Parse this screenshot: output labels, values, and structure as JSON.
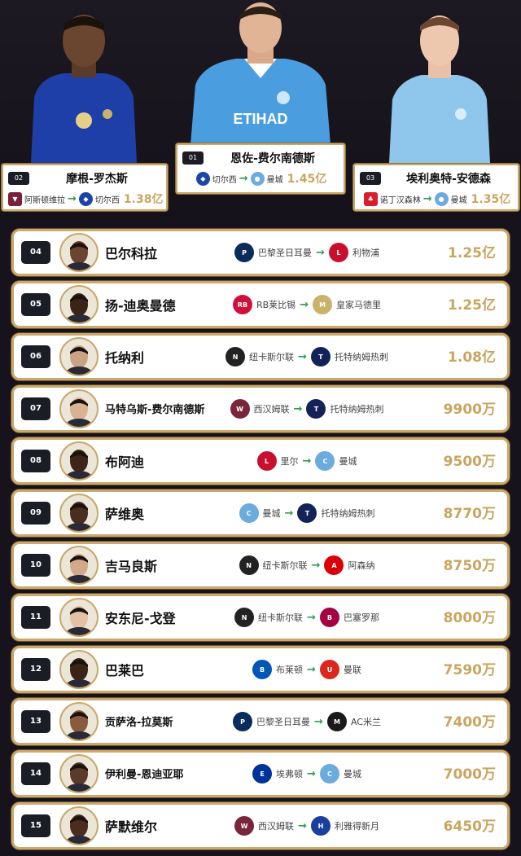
{
  "podium": [
    {
      "rank": "02",
      "name": "摩根-罗杰斯",
      "from": "阿斯顿维拉",
      "from_icon": "aston-villa-crest-icon",
      "to": "切尔西",
      "to_icon": "chelsea-crest-icon",
      "fee": "1.38亿",
      "shirt_color": "#1f3fa8"
    },
    {
      "rank": "01",
      "name": "恩佐-费尔南德斯",
      "from": "切尔西",
      "from_icon": "chelsea-crest-icon",
      "to": "曼城",
      "to_icon": "man-city-crest-icon",
      "fee": "1.45亿",
      "shirt_color": "#4a9ee0",
      "sponsor": "ETIHAD"
    },
    {
      "rank": "03",
      "name": "埃利奥特-安德森",
      "from": "诺丁汉森林",
      "from_icon": "nottingham-forest-crest-icon",
      "to": "曼城",
      "to_icon": "man-city-crest-icon",
      "fee": "1.35亿",
      "shirt_color": "#8ec6ec"
    }
  ],
  "list": [
    {
      "rank": "04",
      "name": "巴尔科拉",
      "from": "巴黎圣日耳曼",
      "from_icon": "psg-crest-icon",
      "to": "利物浦",
      "to_icon": "liverpool-crest-icon",
      "fee": "1.25亿"
    },
    {
      "rank": "05",
      "name": "扬-迪奥曼德",
      "from": "RB莱比锡",
      "from_icon": "rb-leipzig-crest-icon",
      "to": "皇家马德里",
      "to_icon": "real-madrid-crest-icon",
      "fee": "1.25亿"
    },
    {
      "rank": "06",
      "name": "托纳利",
      "from": "纽卡斯尔联",
      "from_icon": "newcastle-crest-icon",
      "to": "托特纳姆热刺",
      "to_icon": "tottenham-crest-icon",
      "fee": "1.08亿"
    },
    {
      "rank": "07",
      "name": "马特乌斯-费尔南德斯",
      "from": "西汉姆联",
      "from_icon": "west-ham-crest-icon",
      "to": "托特纳姆热刺",
      "to_icon": "tottenham-crest-icon",
      "fee": "9900万"
    },
    {
      "rank": "08",
      "name": "布阿迪",
      "from": "里尔",
      "from_icon": "lille-crest-icon",
      "to": "曼城",
      "to_icon": "man-city-crest-icon",
      "fee": "9500万"
    },
    {
      "rank": "09",
      "name": "萨维奥",
      "from": "曼城",
      "from_icon": "man-city-crest-icon",
      "to": "托特纳姆热刺",
      "to_icon": "tottenham-crest-icon",
      "fee": "8770万"
    },
    {
      "rank": "10",
      "name": "吉马良斯",
      "from": "纽卡斯尔联",
      "from_icon": "newcastle-crest-icon",
      "to": "阿森纳",
      "to_icon": "arsenal-crest-icon",
      "fee": "8750万"
    },
    {
      "rank": "11",
      "name": "安东尼-戈登",
      "from": "纽卡斯尔联",
      "from_icon": "newcastle-crest-icon",
      "to": "巴塞罗那",
      "to_icon": "barcelona-crest-icon",
      "fee": "8000万"
    },
    {
      "rank": "12",
      "name": "巴莱巴",
      "from": "布莱顿",
      "from_icon": "brighton-crest-icon",
      "to": "曼联",
      "to_icon": "man-utd-crest-icon",
      "fee": "7590万"
    },
    {
      "rank": "13",
      "name": "贡萨洛-拉莫斯",
      "from": "巴黎圣日耳曼",
      "from_icon": "psg-crest-icon",
      "to": "AC米兰",
      "to_icon": "ac-milan-crest-icon",
      "fee": "7400万"
    },
    {
      "rank": "14",
      "name": "伊利曼-恩迪亚耶",
      "from": "埃弗顿",
      "from_icon": "everton-crest-icon",
      "to": "曼城",
      "to_icon": "man-city-crest-icon",
      "fee": "7000万"
    },
    {
      "rank": "15",
      "name": "萨默维尔",
      "from": "西汉姆联",
      "from_icon": "west-ham-crest-icon",
      "to": "利雅得新月",
      "to_icon": "al-hilal-crest-icon",
      "fee": "6450万"
    }
  ],
  "arrow_symbol": "→",
  "colors": {
    "gold": "#c9a560",
    "border": "#cba86c",
    "arrow": "#2f9e4a",
    "background": "#17131c"
  },
  "club_colors": {
    "aston-villa-crest-icon": "#7a1f3d",
    "chelsea-crest-icon": "#1d45a8",
    "man-city-crest-icon": "#6cabdd",
    "nottingham-forest-crest-icon": "#d81e2c",
    "psg-crest-icon": "#0b2b5b",
    "liverpool-crest-icon": "#c8102e",
    "rb-leipzig-crest-icon": "#d0103a",
    "real-madrid-crest-icon": "#c9b26a",
    "newcastle-crest-icon": "#222222",
    "tottenham-crest-icon": "#132257",
    "west-ham-crest-icon": "#7a263a",
    "lille-crest-icon": "#c8102e",
    "arsenal-crest-icon": "#db0007",
    "barcelona-crest-icon": "#a50044",
    "brighton-crest-icon": "#0057b8",
    "man-utd-crest-icon": "#da291c",
    "ac-milan-crest-icon": "#1a1a1a",
    "everton-crest-icon": "#003399",
    "al-hilal-crest-icon": "#1b3f9c"
  }
}
